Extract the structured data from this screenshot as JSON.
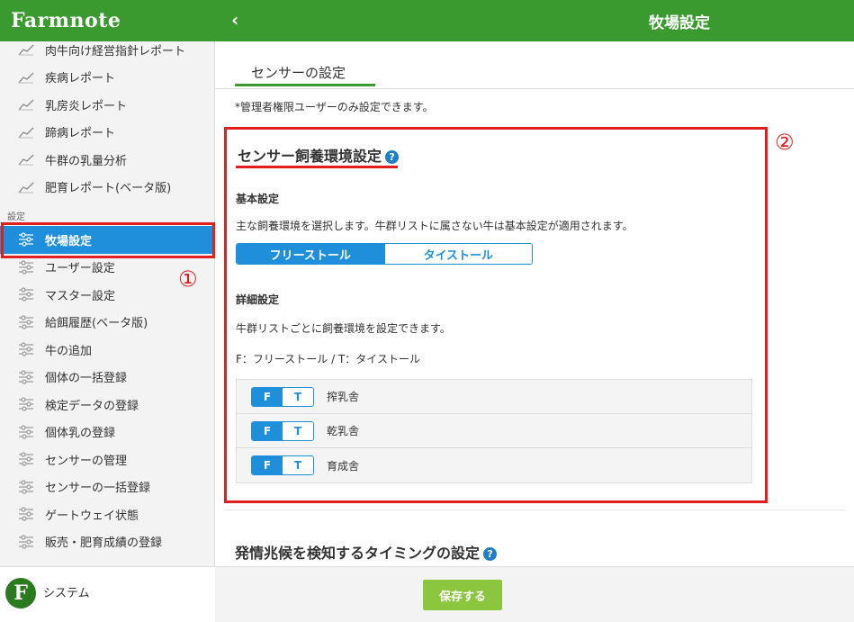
{
  "app": {
    "logo": "Farmnote",
    "page_title": "牧場設定"
  },
  "sidebar": {
    "reports": [
      {
        "label": "肉牛向け経営指針レポート"
      },
      {
        "label": "疾病レポート"
      },
      {
        "label": "乳房炎レポート"
      },
      {
        "label": "蹄病レポート"
      },
      {
        "label": "牛群の乳量分析"
      },
      {
        "label": "肥育レポート(ベータ版)"
      }
    ],
    "section_label": "設定",
    "settings": [
      {
        "label": "牧場設定",
        "active": true
      },
      {
        "label": "ユーザー設定"
      },
      {
        "label": "マスター設定"
      },
      {
        "label": "給餌履歴(ベータ版)"
      },
      {
        "label": "牛の追加"
      },
      {
        "label": "個体の一括登録"
      },
      {
        "label": "検定データの登録"
      },
      {
        "label": "個体乳の登録"
      },
      {
        "label": "センサーの管理"
      },
      {
        "label": "センサーの一括登録"
      },
      {
        "label": "ゲートウェイ状態"
      },
      {
        "label": "販売・肥育成績の登録"
      }
    ],
    "system_label": "システム",
    "annotation": "①"
  },
  "main": {
    "tab_label": "センサーの設定",
    "admin_note": "*管理者権限ユーザーのみ設定できます。",
    "section": {
      "title": "センサー飼養環境設定",
      "annotation": "②",
      "basic_heading": "基本設定",
      "basic_desc": "主な飼養環境を選択します。牛群リストに属さない牛は基本設定が適用されます。",
      "option_free": "フリーストール",
      "option_tie": "タイストール",
      "detail_heading": "詳細設定",
      "detail_desc": "牛群リストごとに飼養環境を設定できます。",
      "legend": "F：フリーストール / T：タイストール",
      "pens": [
        {
          "f": "F",
          "t": "T",
          "name": "搾乳舎"
        },
        {
          "f": "F",
          "t": "T",
          "name": "乾乳舎"
        },
        {
          "f": "F",
          "t": "T",
          "name": "育成舎"
        }
      ]
    },
    "estrus_title": "発情兆候を検知するタイミングの設定",
    "save_label": "保存する"
  },
  "colors": {
    "brand_green": "#3b9a2f",
    "accent_blue": "#1f8fdc",
    "annotation_red": "#e02020",
    "save_green": "#8cc63f"
  }
}
